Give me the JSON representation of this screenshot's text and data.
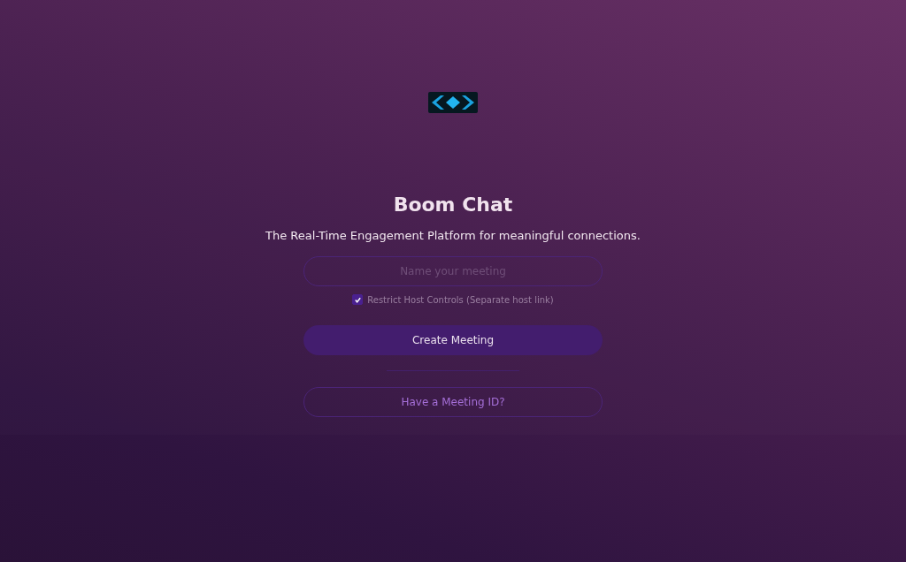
{
  "title": "Boom Chat",
  "tagline": "The Real-Time Engagement Platform for meaningful  connections.",
  "meeting_name": {
    "placeholder": "Name your meeting"
  },
  "restrict": {
    "label": "Restrict Host Controls (Separate host link)",
    "checked": true
  },
  "create_button": "Create Meeting",
  "join_button": "Have a Meeting ID?"
}
